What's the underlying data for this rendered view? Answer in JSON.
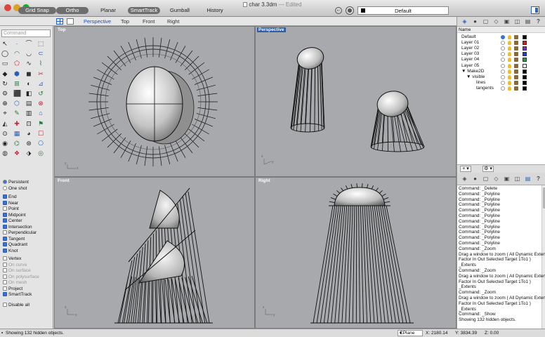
{
  "window": {
    "title": "char 3.3dm",
    "title_suffix": "— Edited"
  },
  "toolbar": {
    "modes": [
      {
        "label": "Grid Snap",
        "on": true
      },
      {
        "label": "Ortho",
        "on": true
      },
      {
        "label": "Planar",
        "on": false
      },
      {
        "label": "SmartTrack",
        "on": true
      },
      {
        "label": "Gumball",
        "on": false
      },
      {
        "label": "History",
        "on": false
      }
    ],
    "current_layer": "Default"
  },
  "view_tabs": [
    "Perspective",
    "Top",
    "Front",
    "Right"
  ],
  "active_view_tab": "Perspective",
  "command": {
    "placeholder": "Command"
  },
  "viewports": {
    "top": {
      "label": "Top"
    },
    "perspective": {
      "label": "Perspective"
    },
    "front": {
      "label": "Front"
    },
    "right": {
      "label": "Right"
    }
  },
  "osnaps": [
    {
      "label": "Persistent",
      "kind": "radio",
      "on": true
    },
    {
      "label": "One shot",
      "kind": "radio",
      "on": false
    },
    {
      "label": "End",
      "kind": "check",
      "on": true
    },
    {
      "label": "Near",
      "kind": "check",
      "on": true
    },
    {
      "label": "Point",
      "kind": "check",
      "on": false
    },
    {
      "label": "Midpoint",
      "kind": "check",
      "on": true
    },
    {
      "label": "Center",
      "kind": "check",
      "on": true
    },
    {
      "label": "Intersection",
      "kind": "check",
      "on": true
    },
    {
      "label": "Perpendicular",
      "kind": "check",
      "on": false
    },
    {
      "label": "Tangent",
      "kind": "check",
      "on": true
    },
    {
      "label": "Quadrant",
      "kind": "check",
      "on": true
    },
    {
      "label": "Knot",
      "kind": "check",
      "on": true
    },
    {
      "label": "Vertex",
      "kind": "check",
      "on": false
    },
    {
      "label": "On curve",
      "kind": "check",
      "on": false,
      "dim": true
    },
    {
      "label": "On surface",
      "kind": "check",
      "on": false,
      "dim": true
    },
    {
      "label": "On polysurface",
      "kind": "check",
      "on": false,
      "dim": true
    },
    {
      "label": "On mesh",
      "kind": "check",
      "on": false,
      "dim": true
    },
    {
      "label": "Project",
      "kind": "check",
      "on": false
    },
    {
      "label": "SmartTrack",
      "kind": "check",
      "on": true
    },
    {
      "label": "Disable all",
      "kind": "check",
      "on": false
    }
  ],
  "layers": {
    "header": "Name",
    "rows": [
      {
        "name": "Default",
        "indent": 0,
        "current": true,
        "color": "#000000"
      },
      {
        "name": "Layer 01",
        "indent": 0,
        "current": false,
        "color": "#d62020"
      },
      {
        "name": "Layer 02",
        "indent": 0,
        "current": false,
        "color": "#7a30c8"
      },
      {
        "name": "Layer 03",
        "indent": 0,
        "current": false,
        "color": "#2040d0"
      },
      {
        "name": "Layer 04",
        "indent": 0,
        "current": false,
        "color": "#20a040"
      },
      {
        "name": "Layer 05",
        "indent": 0,
        "current": false,
        "color": "#ffffff"
      },
      {
        "name": "▼ Make2D",
        "indent": 0,
        "current": false,
        "color": "#000000"
      },
      {
        "name": "▼ visible",
        "indent": 1,
        "current": false,
        "color": "#000000"
      },
      {
        "name": "lines",
        "indent": 3,
        "current": false,
        "color": "#000000"
      },
      {
        "name": "tangents",
        "indent": 3,
        "current": false,
        "color": "#000000"
      }
    ]
  },
  "history": [
    "Command: _Delete",
    "Command: _Polyline",
    "Command: _Polyline",
    "Command: _Polyline",
    "Command: _Polyline",
    "Command: _Polyline",
    "Command: _Polyline",
    "Command: _Polyline",
    "Command: _Polyline",
    "Command: _Polyline",
    "Command: _Polyline",
    "Command: _Zoom",
    "Drag a window to zoom ( All Dynamic Extents",
    "Factor In Out Selected Target 1To1 )",
    "_Extents",
    "Command: _Zoom",
    "Drag a window to zoom ( All Dynamic Extents",
    "Factor In Out Selected Target 1To1 )",
    "_Extents",
    "Command: _Zoom",
    "Drag a window to zoom ( All Dynamic Extents",
    "Factor In Out Selected Target 1To1 )",
    "_Extents",
    "Command: _Show",
    "Showing 132 hidden objects."
  ],
  "status": {
    "message": "Showing 132 hidden objects.",
    "cplane": "CPlane",
    "x": "X: 2180.14",
    "y": "Y: 3834.39",
    "z": "Z: 0.00"
  }
}
